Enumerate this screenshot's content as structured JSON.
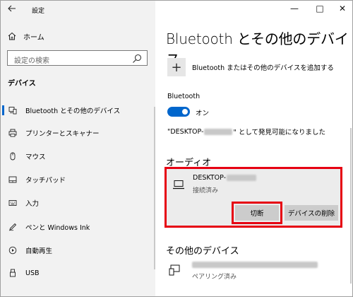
{
  "window": {
    "title": "設定",
    "controls": {
      "minimize": "—",
      "maximize": "□",
      "close": "✕"
    }
  },
  "sidebar": {
    "back_icon": "back-arrow-icon",
    "home_label": "ホーム",
    "search_placeholder": "設定の検索",
    "section_title": "デバイス",
    "items": [
      {
        "label": "Bluetooth とその他のデバイス",
        "icon": "devices-icon",
        "active": true
      },
      {
        "label": "プリンターとスキャナー",
        "icon": "printer-icon",
        "active": false
      },
      {
        "label": "マウス",
        "icon": "mouse-icon",
        "active": false
      },
      {
        "label": "タッチパッド",
        "icon": "touchpad-icon",
        "active": false
      },
      {
        "label": "入力",
        "icon": "keyboard-icon",
        "active": false
      },
      {
        "label": "ペンと Windows Ink",
        "icon": "pen-icon",
        "active": false
      },
      {
        "label": "自動再生",
        "icon": "autoplay-icon",
        "active": false
      },
      {
        "label": "USB",
        "icon": "usb-icon",
        "active": false
      }
    ]
  },
  "main": {
    "title": "Bluetooth とその他のデバイス",
    "add_device_label": "Bluetooth またはその他のデバイスを追加する",
    "bluetooth_label": "Bluetooth",
    "toggle_state": "オン",
    "discoverable_prefix": "\"DESKTOP-",
    "discoverable_suffix": "\" として発見可能になりました",
    "audio_section": "オーディオ",
    "audio_device": {
      "name_prefix": "DESKTOP-",
      "status": "接続済み",
      "disconnect_label": "切断",
      "remove_label": "デバイスの削除"
    },
    "other_section": "その他のデバイス",
    "other_device": {
      "status": "ペアリング済み"
    }
  },
  "colors": {
    "accent": "#0066cc",
    "highlight": "#e60012",
    "sidebar_bg": "#f2f2f2",
    "card_bg": "#ececec",
    "button_bg": "#cccccc"
  }
}
